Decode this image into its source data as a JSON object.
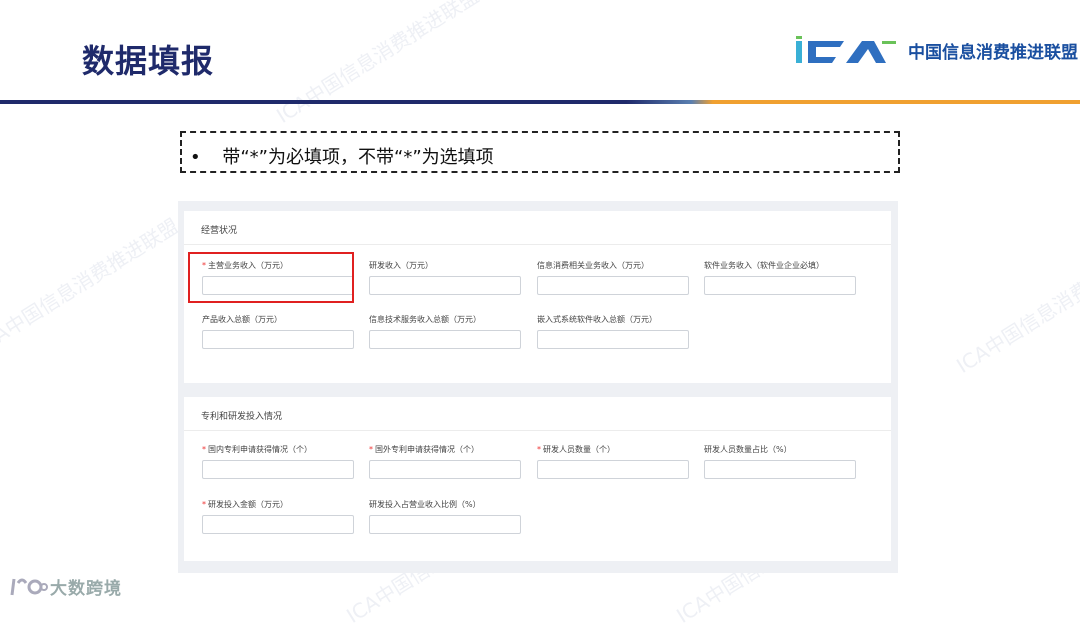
{
  "header": {
    "title": "数据填报",
    "logo_mark": "ICA",
    "logo_text": "中国信息消费推进联盟"
  },
  "colors": {
    "title": "#1f2a6b",
    "rule_left": "#1f2a6b",
    "rule_right": "#f0a030",
    "highlight": "#e02020",
    "required": "#e33333"
  },
  "note": {
    "bullet": "•",
    "text": "带“*”为必填项，不带“*”为选填项"
  },
  "sections": [
    {
      "title": "经营状况",
      "fields": [
        {
          "label": "主营业务收入（万元）",
          "required": true
        },
        {
          "label": "研发收入（万元）",
          "required": false
        },
        {
          "label": "信息消费相关业务收入（万元）",
          "required": false
        },
        {
          "label": "软件业务收入（软件业企业必填）",
          "required": false
        },
        {
          "label": "产品收入总额（万元）",
          "required": false
        },
        {
          "label": "信息技术服务收入总额（万元）",
          "required": false
        },
        {
          "label": "嵌入式系统软件收入总额（万元）",
          "required": false
        }
      ]
    },
    {
      "title": "专利和研发投入情况",
      "fields": [
        {
          "label": "国内专利申请获得情况（个）",
          "required": true
        },
        {
          "label": "国外专利申请获得情况（个）",
          "required": true
        },
        {
          "label": "研发人员数量（个）",
          "required": true
        },
        {
          "label": "研发人员数量占比（%）",
          "required": false
        },
        {
          "label": "研发投入金额（万元）",
          "required": true
        },
        {
          "label": "研发投入占营业收入比例（%）",
          "required": false
        }
      ]
    }
  ],
  "watermark": "ICA中国信息消费推进联盟",
  "footer": {
    "brand": "大数跨境"
  }
}
